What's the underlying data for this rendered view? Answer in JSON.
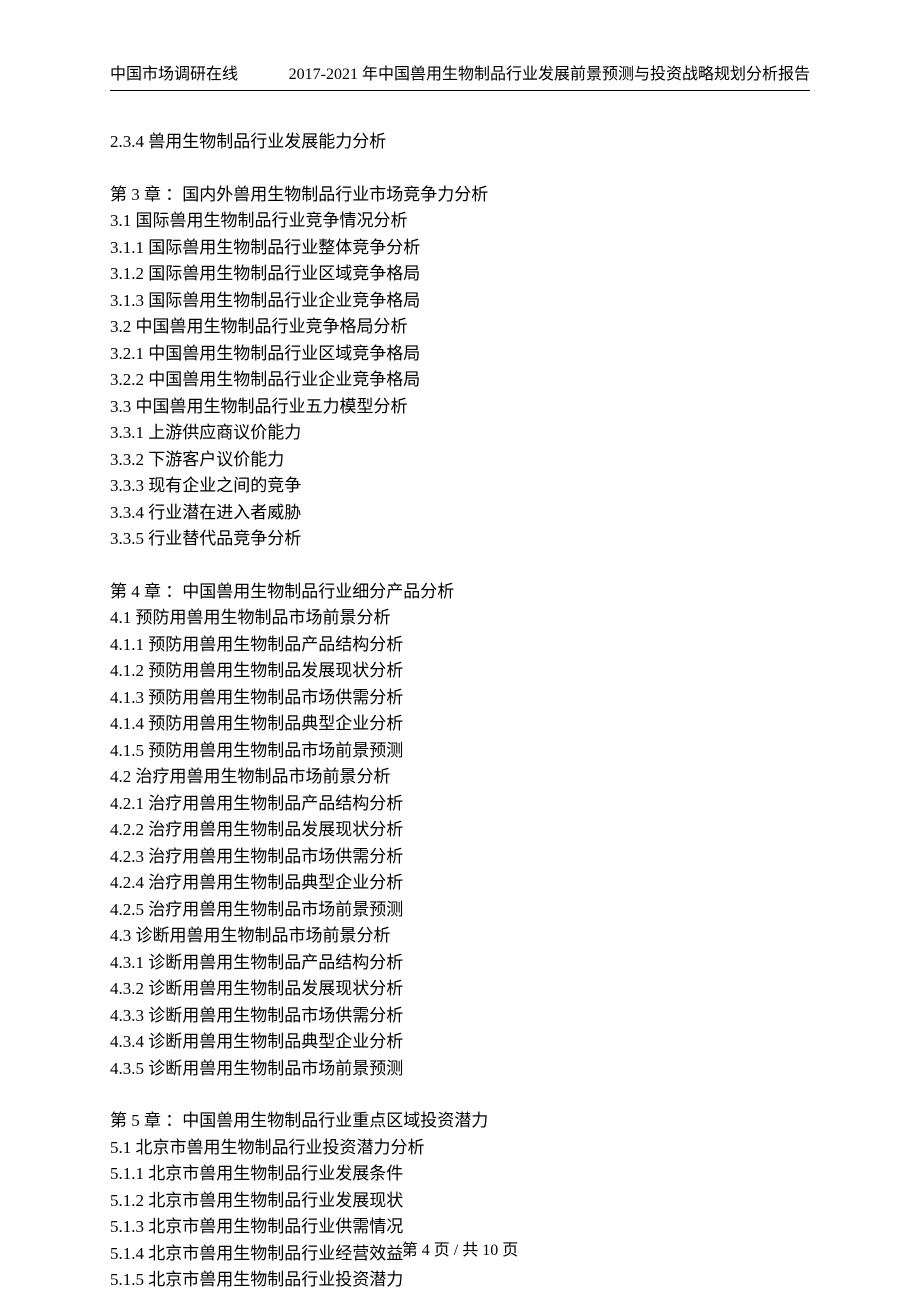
{
  "header": {
    "left": "中国市场调研在线",
    "right": "2017-2021 年中国兽用生物制品行业发展前景预测与投资战略规划分析报告"
  },
  "toc": [
    "2.3.4 兽用生物制品行业发展能力分析",
    "",
    "第 3 章 ：国内外兽用生物制品行业市场竞争力分析",
    "3.1 国际兽用生物制品行业竞争情况分析",
    "3.1.1 国际兽用生物制品行业整体竞争分析",
    "3.1.2 国际兽用生物制品行业区域竞争格局",
    "3.1.3 国际兽用生物制品行业企业竞争格局",
    "3.2 中国兽用生物制品行业竞争格局分析",
    "3.2.1 中国兽用生物制品行业区域竞争格局",
    "3.2.2 中国兽用生物制品行业企业竞争格局",
    "3.3 中国兽用生物制品行业五力模型分析",
    "3.3.1 上游供应商议价能力",
    "3.3.2 下游客户议价能力",
    "3.3.3 现有企业之间的竞争",
    "3.3.4 行业潜在进入者威胁",
    "3.3.5 行业替代品竞争分析",
    "",
    "第 4 章 ：中国兽用生物制品行业细分产品分析",
    "4.1 预防用兽用生物制品市场前景分析",
    "4.1.1 预防用兽用生物制品产品结构分析",
    "4.1.2 预防用兽用生物制品发展现状分析",
    "4.1.3 预防用兽用生物制品市场供需分析",
    "4.1.4 预防用兽用生物制品典型企业分析",
    "4.1.5 预防用兽用生物制品市场前景预测",
    "4.2 治疗用兽用生物制品市场前景分析",
    "4.2.1 治疗用兽用生物制品产品结构分析",
    "4.2.2 治疗用兽用生物制品发展现状分析",
    "4.2.3 治疗用兽用生物制品市场供需分析",
    "4.2.4 治疗用兽用生物制品典型企业分析",
    "4.2.5 治疗用兽用生物制品市场前景预测",
    "4.3 诊断用兽用生物制品市场前景分析",
    "4.3.1 诊断用兽用生物制品产品结构分析",
    "4.3.2 诊断用兽用生物制品发展现状分析",
    "4.3.3 诊断用兽用生物制品市场供需分析",
    "4.3.4 诊断用兽用生物制品典型企业分析",
    "4.3.5 诊断用兽用生物制品市场前景预测",
    "",
    "第 5 章 ：中国兽用生物制品行业重点区域投资潜力",
    "5.1 北京市兽用生物制品行业投资潜力分析",
    "5.1.1 北京市兽用生物制品行业发展条件",
    "5.1.2 北京市兽用生物制品行业发展现状",
    "5.1.3 北京市兽用生物制品行业供需情况",
    "5.1.4 北京市兽用生物制品行业经营效益",
    "5.1.5 北京市兽用生物制品行业投资潜力"
  ],
  "footer": {
    "prefix": "第 ",
    "current": "4",
    "mid": " 页 / 共 ",
    "total": "10",
    "suffix": " 页"
  }
}
